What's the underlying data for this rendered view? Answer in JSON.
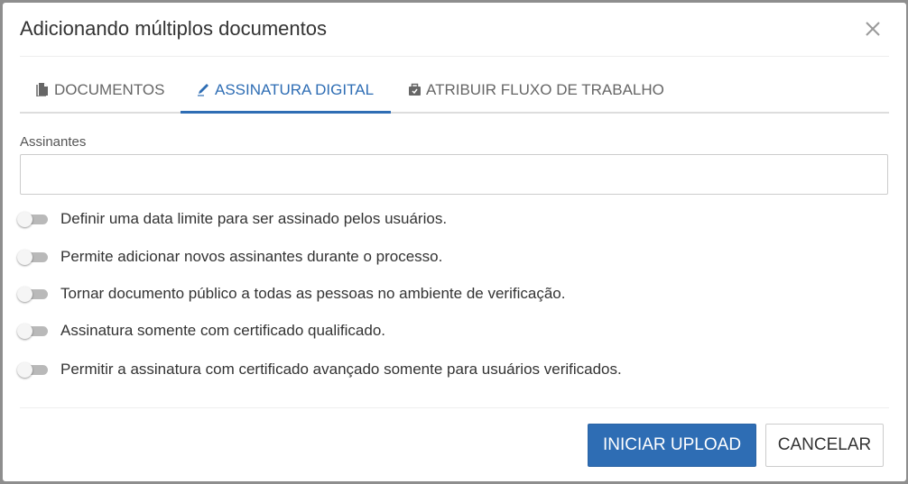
{
  "modal": {
    "title": "Adicionando múltiplos documentos",
    "close_icon": "close-icon"
  },
  "tabs": [
    {
      "label": "DOCUMENTOS",
      "icon": "document-icon",
      "active": false
    },
    {
      "label": "ASSINATURA DIGITAL",
      "icon": "pen-icon",
      "active": true
    },
    {
      "label": "ATRIBUIR FLUXO DE TRABALHO",
      "icon": "briefcase-icon",
      "active": false
    }
  ],
  "signers": {
    "label": "Assinantes",
    "value": "",
    "placeholder": ""
  },
  "options": [
    {
      "label": "Definir uma data limite para ser assinado pelos usuários.",
      "enabled": false
    },
    {
      "label": "Permite adicionar novos assinantes durante o processo.",
      "enabled": false
    },
    {
      "label": "Tornar documento público a todas as pessoas no ambiente de verificação.",
      "enabled": false
    },
    {
      "label": "Assinatura somente com certificado qualificado.",
      "enabled": false
    },
    {
      "label": "Permitir a assinatura com certificado avançado somente para usuários verificados.",
      "enabled": false
    }
  ],
  "footer": {
    "primary_label": "INICIAR UPLOAD",
    "secondary_label": "CANCELAR"
  },
  "colors": {
    "accent": "#2e6db4",
    "overlay": "#8e8e8e",
    "toggle_off": "#b9b9b9"
  }
}
